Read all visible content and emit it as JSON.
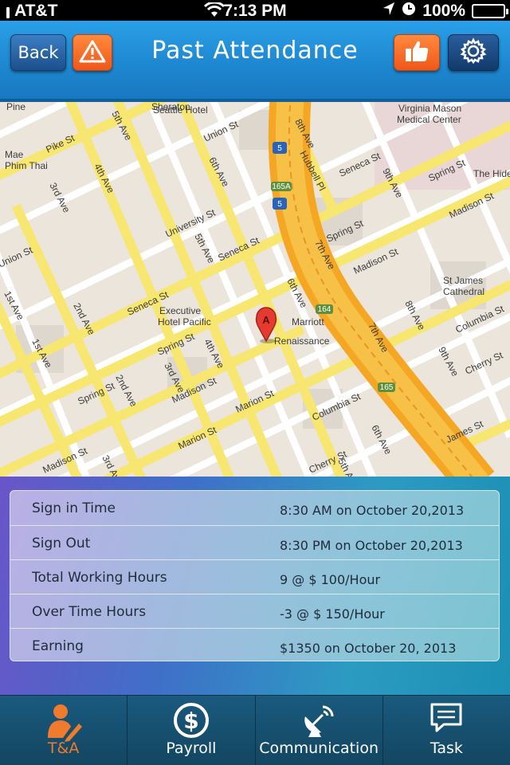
{
  "status_bar": {
    "carrier": "AT&T",
    "time": "7:13 PM",
    "battery": "100%",
    "icons": [
      "signal-icon",
      "wifi-icon",
      "location-arrow-icon",
      "alarm-icon",
      "battery-icon"
    ]
  },
  "nav": {
    "back_label": "Back",
    "title": "Past Attendance",
    "alert_icon": "warning-icon",
    "like_icon": "thumbs-up-icon",
    "settings_icon": "gear-icon"
  },
  "map": {
    "marker_label": "A",
    "street_labels": [
      "Pine",
      "Pike St",
      "4th Ave",
      "3rd Ave",
      "Union St",
      "1st Ave",
      "2nd Ave",
      "Seneca St",
      "University St",
      "5th Ave",
      "6th Ave",
      "7th Ave",
      "8th Ave",
      "Hubbell Pl",
      "Spring St",
      "Madison St",
      "Marion St",
      "Columbia St",
      "Cherry St",
      "James St",
      "9th Ave",
      "Union St",
      "Seneca St",
      "Spring St",
      "Madison St",
      "Marion St",
      "Columbia St"
    ],
    "place_labels": [
      "Sheraton Seattle Hotel",
      "Mae Phim Thai",
      "Executive Hotel Pacific",
      "Marriott Renaissance",
      "Virginia Mason Medical Center",
      "St James Cathedral",
      "The Hideo"
    ],
    "highway_labels": [
      "5",
      "165A",
      "164",
      "165"
    ]
  },
  "attendance": {
    "rows": [
      {
        "label": "Sign in Time",
        "value": "8:30 AM on October 20,2013"
      },
      {
        "label": "Sign Out",
        "value": "8:30 PM on October 20,2013"
      },
      {
        "label": "Total Working Hours",
        "value": "9 @ $ 100/Hour"
      },
      {
        "label": "Over Time Hours",
        "value": "-3 @ $ 150/Hour"
      },
      {
        "label": "Earning",
        "value": "$1350 on October 20, 2013"
      }
    ]
  },
  "tabs": [
    {
      "label": "T&A",
      "icon": "person-pencil-icon",
      "active": true
    },
    {
      "label": "Payroll",
      "icon": "dollar-circle-icon",
      "active": false
    },
    {
      "label": "Communication",
      "icon": "satellite-dish-icon",
      "active": false
    },
    {
      "label": "Task",
      "icon": "speech-bubble-icon",
      "active": false
    }
  ],
  "colors": {
    "nav_blue": "#1d86cf",
    "accent_orange": "#f0571a",
    "active_tab": "#f07a2e",
    "road_yellow": "#f7e66f",
    "highway_orange": "#f5a623"
  }
}
